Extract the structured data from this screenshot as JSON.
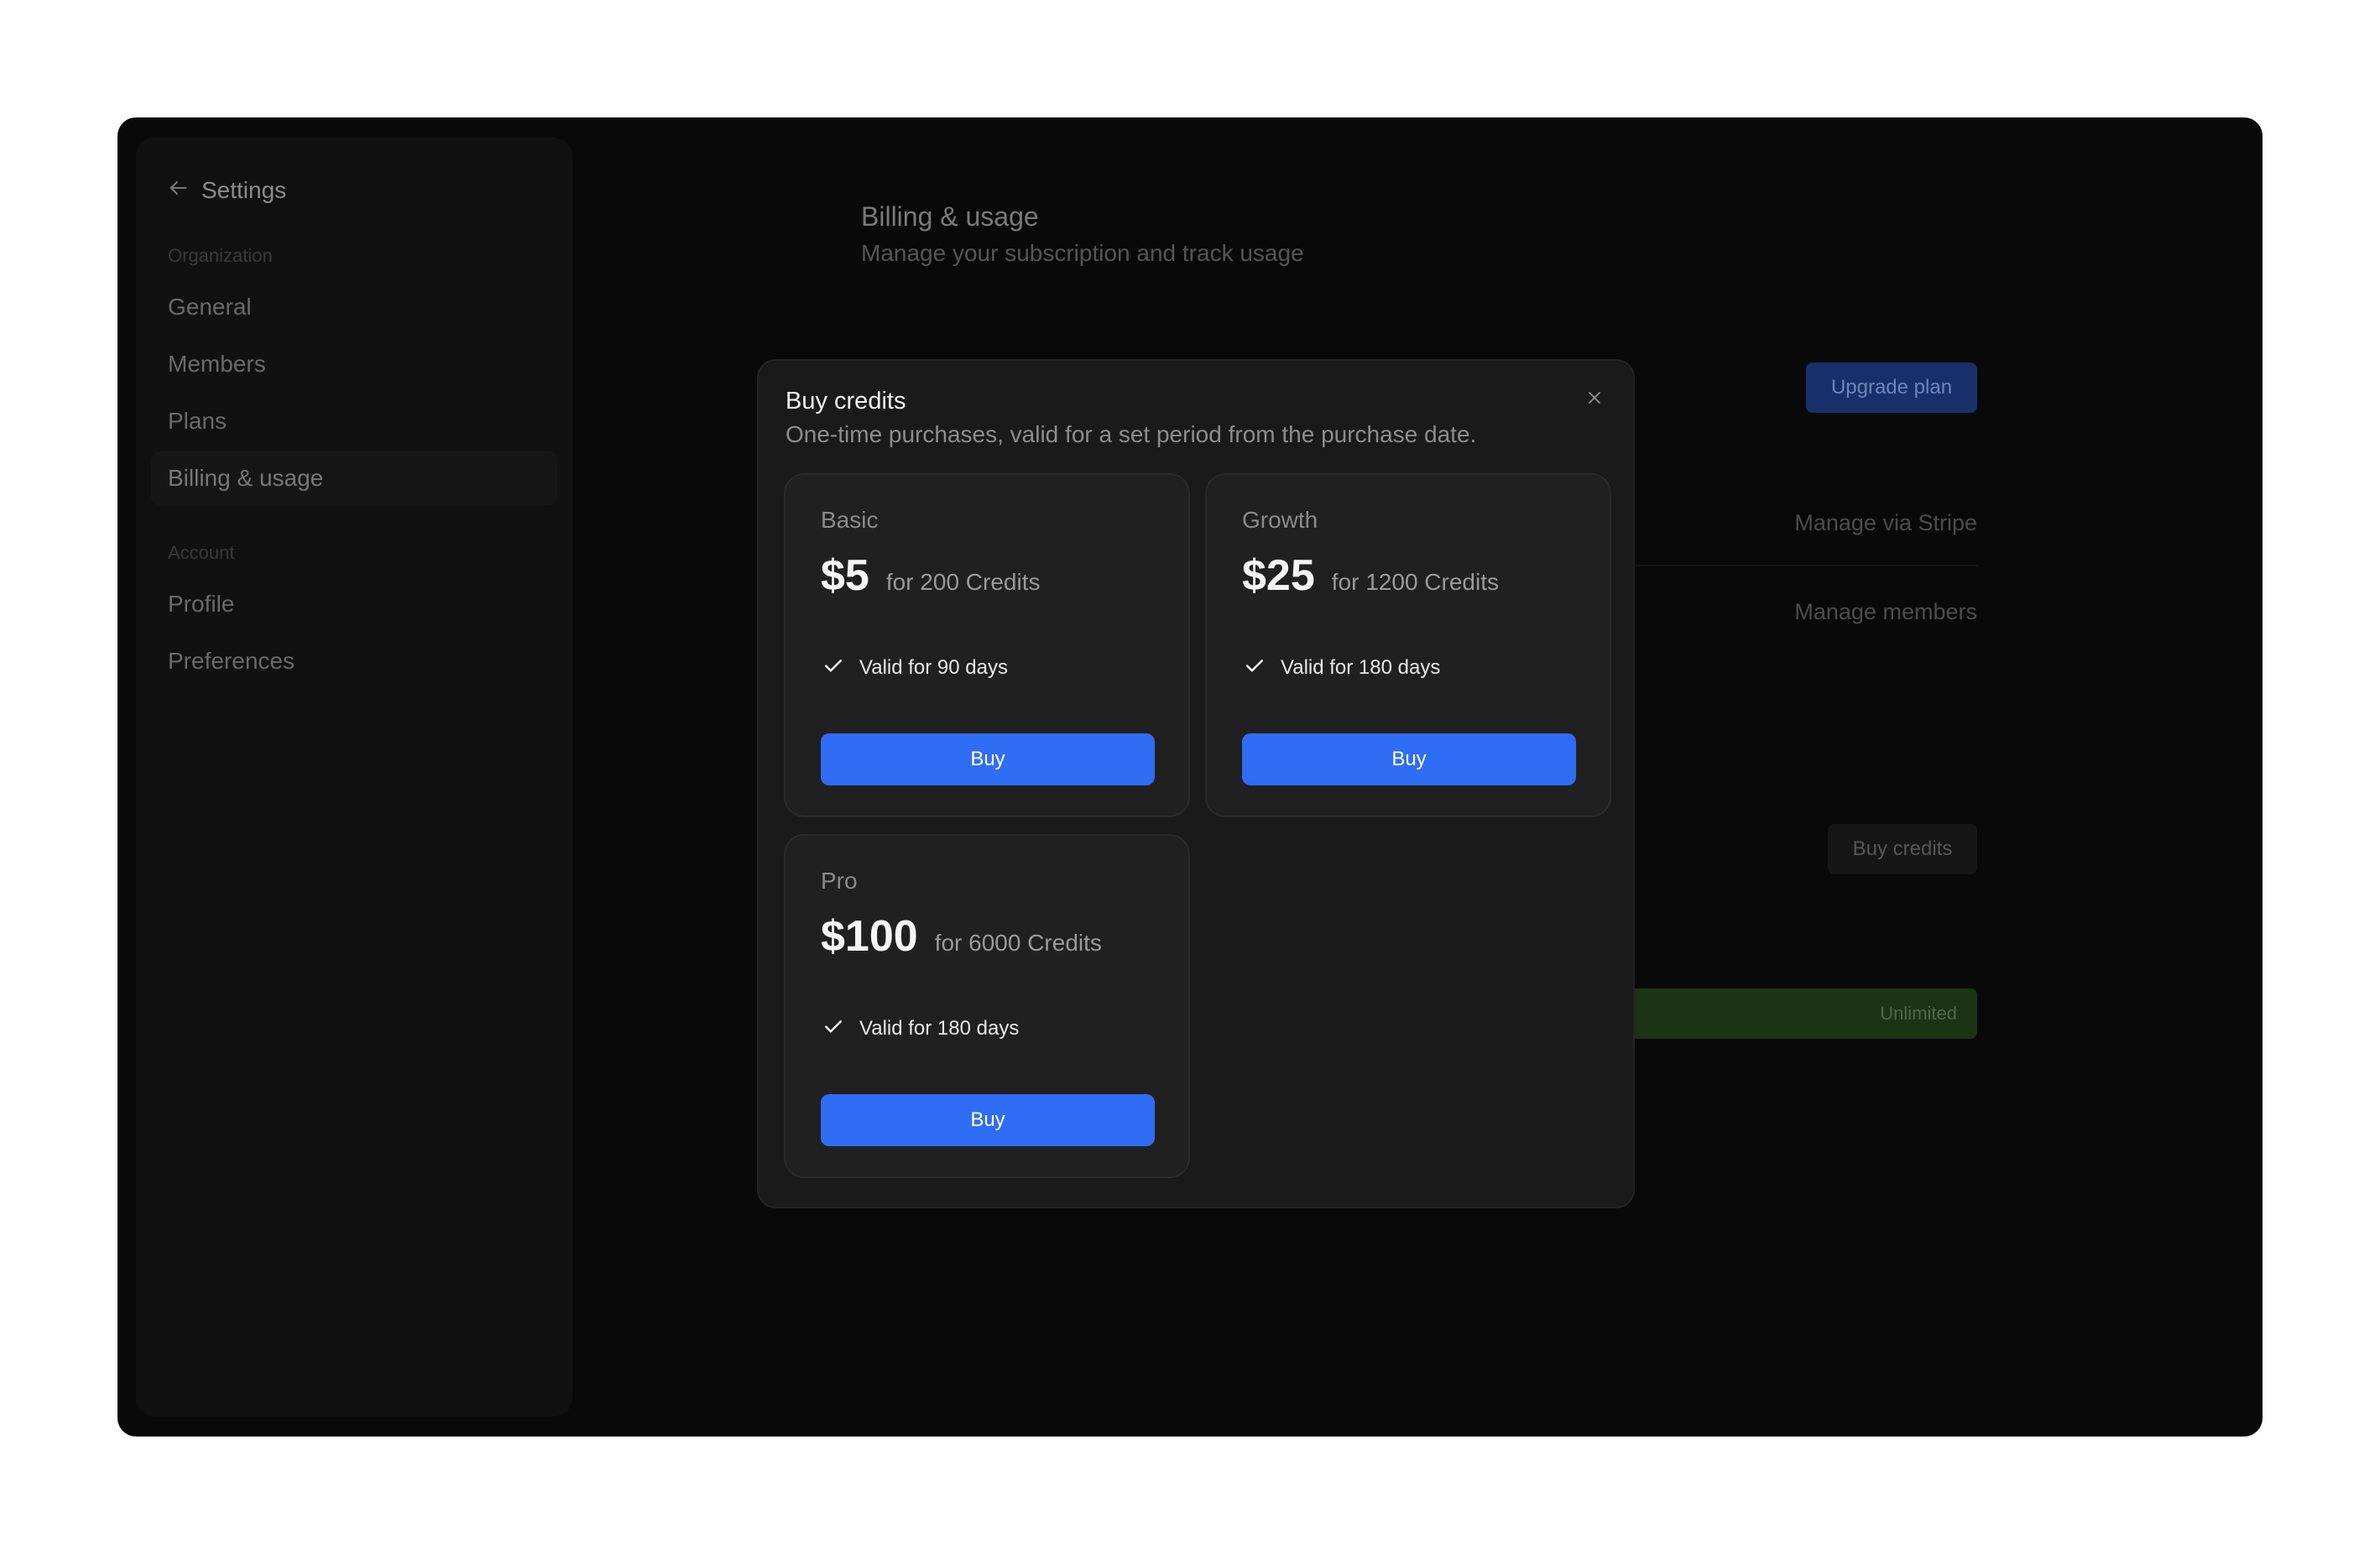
{
  "sidebar": {
    "back_label": "Settings",
    "sections": [
      {
        "label": "Organization",
        "items": [
          {
            "label": "General"
          },
          {
            "label": "Members"
          },
          {
            "label": "Plans"
          },
          {
            "label": "Billing & usage",
            "active": true
          }
        ]
      },
      {
        "label": "Account",
        "items": [
          {
            "label": "Profile"
          },
          {
            "label": "Preferences"
          }
        ]
      }
    ]
  },
  "page": {
    "title": "Billing & usage",
    "subtitle": "Manage your subscription and track usage",
    "upgrade_label": "Upgrade plan",
    "manage_stripe_label": "Manage via Stripe",
    "manage_members_label": "Manage members",
    "buy_credits_label": "Buy credits",
    "usage_label": "Unlimited"
  },
  "modal": {
    "title": "Buy credits",
    "description": "One-time purchases, valid for a set period from the purchase date.",
    "close_icon": "close-icon",
    "plans": [
      {
        "name": "Basic",
        "price": "$5",
        "credits": "for 200 Credits",
        "feature": "Valid for 90 days",
        "button": "Buy"
      },
      {
        "name": "Growth",
        "price": "$25",
        "credits": "for 1200 Credits",
        "feature": "Valid for 180 days",
        "button": "Buy"
      },
      {
        "name": "Pro",
        "price": "$100",
        "credits": "for 6000 Credits",
        "feature": "Valid for 180 days",
        "button": "Buy"
      }
    ]
  },
  "colors": {
    "accent": "#2f6df4",
    "window_bg": "#090909",
    "modal_bg": "#1a1a1a",
    "usage_bar": "#1c3414"
  },
  "icons": {
    "back": "arrow-left-icon",
    "check": "check-icon",
    "chat": "chat-icon"
  }
}
